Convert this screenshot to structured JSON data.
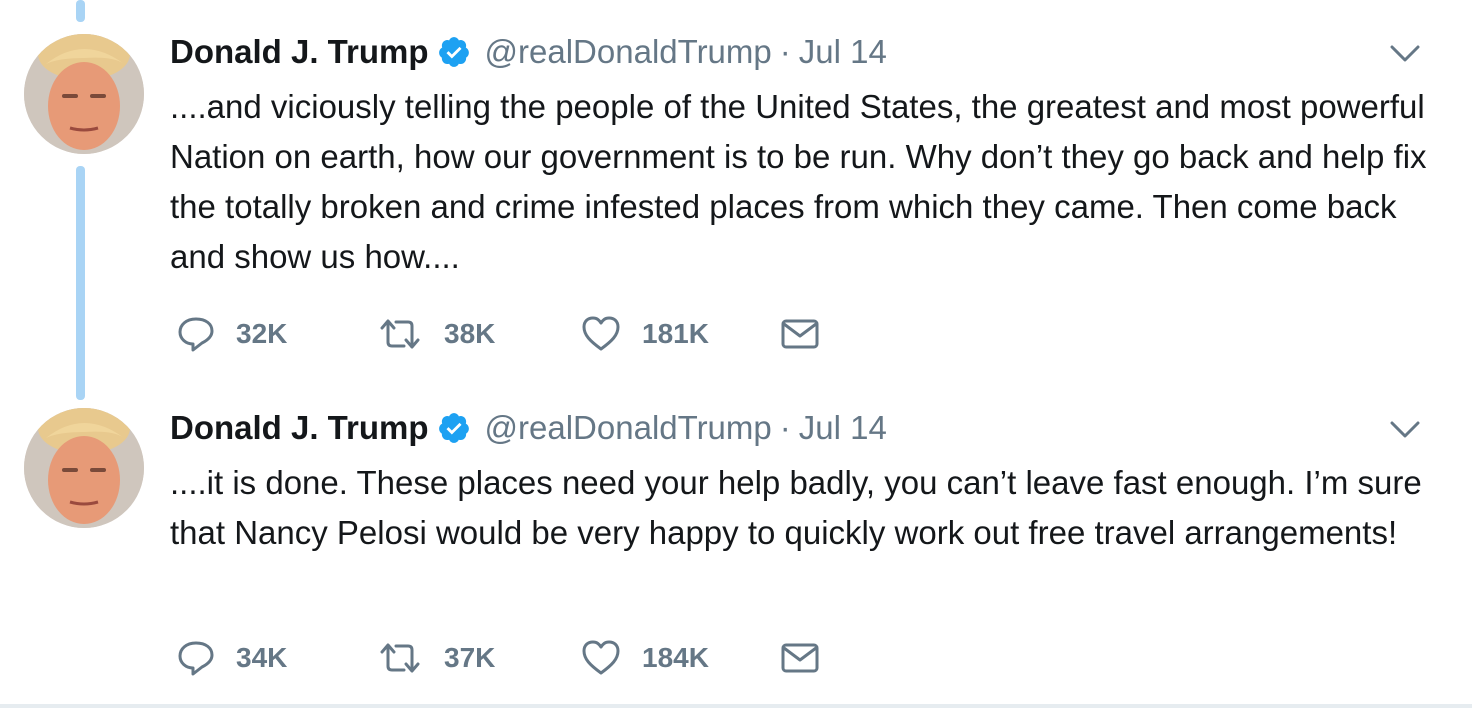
{
  "colors": {
    "text": "#14171a",
    "muted": "#657786",
    "verified": "#1da1f2",
    "thread_line": "#a9d4f5"
  },
  "tweets": [
    {
      "author_name": "Donald J. Trump",
      "handle": "@realDonaldTrump",
      "separator": "·",
      "date": "Jul 14",
      "text": "....and viciously telling the people of the United States, the greatest and most powerful Nation on earth, how our government is to be run. Why don’t they go back and help fix the totally broken and crime infested places from which they came. Then come back and show us how....",
      "replies": "32K",
      "retweets": "38K",
      "likes": "181K"
    },
    {
      "author_name": "Donald J. Trump",
      "handle": "@realDonaldTrump",
      "separator": "·",
      "date": "Jul 14",
      "text": "....it is done. These places need your help badly, you can’t leave fast enough. I’m sure that Nancy Pelosi would be very happy to quickly work out free travel arrangements!",
      "replies": "34K",
      "retweets": "37K",
      "likes": "184K"
    }
  ]
}
